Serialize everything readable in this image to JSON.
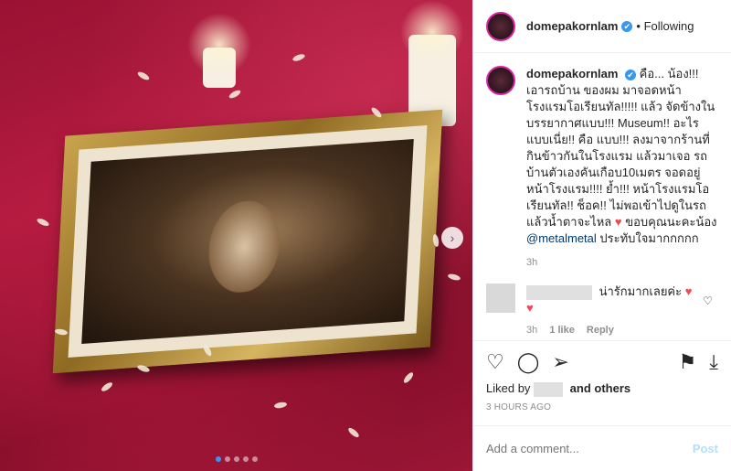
{
  "header": {
    "username": "domepakornlam",
    "verified_icon": "✔",
    "follow_label": "• Following"
  },
  "caption": {
    "username": "domepakornlam",
    "text": "คือ... น้อง!!! เอารถบ้าน ของผม มาจอดหน้า โรงแรมโอเรียนทัล!!!!! แล้ว จัดข้างในบรรยากาศแบบ!!! Museum!! อะไรแบบเนี่ย!! คือ แบบ!!! ลงมาจากร้านที่กินข้าวกันในโรงแรม แล้วมาเจอ รถบ้านตัวเองคันเกือบ10เมตร จอดอยู่หน้าโรงแรม!!!! ย้ำ!!! หน้าโรงแรมโอเรียนทัล!! ช็อค!! ไม่พอเข้าไปดูในรถแล้วน้ำตาจะไหล",
    "text_after_heart": " ขอบคุณนะคะน้อง ",
    "mention": "@metalmetal",
    "closing": " ประทับใจมากกกกก",
    "time": "3h"
  },
  "comments": [
    {
      "text": "น่ารักมากเลยค่ะ",
      "time": "3h",
      "likes": "1 like",
      "reply": "Reply"
    },
    {
      "text": ""
    }
  ],
  "likes": {
    "prefix": "Liked by",
    "suffix": "and others"
  },
  "timestamp": "3 HOURS AGO",
  "add_comment": {
    "placeholder": "Add a comment...",
    "post_label": "Post"
  },
  "carousel": {
    "total": 5,
    "active": 1
  },
  "colors": {
    "verified": "#3897f0",
    "heart": "#ed4956",
    "post_disabled": "#b2dffc"
  }
}
